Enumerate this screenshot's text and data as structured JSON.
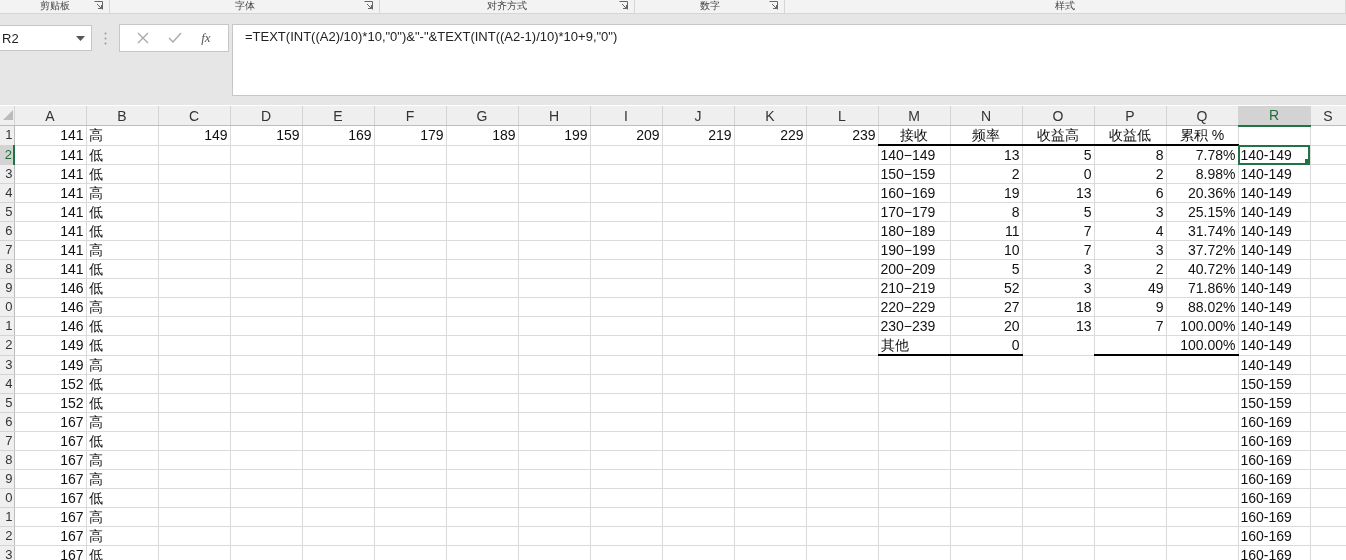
{
  "ribbon_groups": [
    {
      "label": "剪贴板",
      "launcher": true
    },
    {
      "label": "字体",
      "launcher": true
    },
    {
      "label": "对齐方式",
      "launcher": true
    },
    {
      "label": "数字",
      "launcher": true
    },
    {
      "label": "样式",
      "launcher": false
    }
  ],
  "formula_bar": {
    "name_box": "R2",
    "function_label": "fx",
    "formula": "=TEXT(INT((A2)/10)*10,\"0\")&\"-\"&TEXT(INT((A2-1)/10)*10+9,\"0\")"
  },
  "columns": [
    {
      "label": "A",
      "kind": "number",
      "selected": false
    },
    {
      "label": "B",
      "kind": "text",
      "selected": false
    },
    {
      "label": "C",
      "kind": "number",
      "selected": false
    },
    {
      "label": "D",
      "kind": "number",
      "selected": false
    },
    {
      "label": "E",
      "kind": "number",
      "selected": false
    },
    {
      "label": "F",
      "kind": "number",
      "selected": false
    },
    {
      "label": "G",
      "kind": "number",
      "selected": false
    },
    {
      "label": "H",
      "kind": "number",
      "selected": false
    },
    {
      "label": "I",
      "kind": "number",
      "selected": false
    },
    {
      "label": "J",
      "kind": "number",
      "selected": false
    },
    {
      "label": "K",
      "kind": "number",
      "selected": false
    },
    {
      "label": "L",
      "kind": "number",
      "selected": false
    },
    {
      "label": "M",
      "kind": "text",
      "selected": false
    },
    {
      "label": "N",
      "kind": "number",
      "selected": false
    },
    {
      "label": "O",
      "kind": "number",
      "selected": false
    },
    {
      "label": "P",
      "kind": "number",
      "selected": false
    },
    {
      "label": "Q",
      "kind": "number",
      "selected": false
    },
    {
      "label": "R",
      "kind": "text",
      "selected": true
    },
    {
      "label": "S",
      "selected": false
    }
  ],
  "rows": [
    {
      "header": "1",
      "selected": false,
      "cells": [
        "141",
        "高",
        "149",
        "159",
        "169",
        "179",
        "189",
        "199",
        "209",
        "219",
        "229",
        "239",
        {
          "text": "接收",
          "kind": "heading",
          "rule": true
        },
        {
          "text": "频率",
          "kind": "heading",
          "rule": true
        },
        {
          "text": "收益高",
          "kind": "heading",
          "rule": true
        },
        {
          "text": "收益低",
          "kind": "heading",
          "rule": true
        },
        {
          "text": "累积 %",
          "kind": "heading",
          "rule": true
        },
        null
      ]
    },
    {
      "header": "2",
      "selected": true,
      "cells": [
        "141",
        "低",
        null,
        null,
        null,
        null,
        null,
        null,
        null,
        null,
        null,
        null,
        "140−149",
        "13",
        "5",
        "8",
        "7.78%",
        {
          "text": "140-149",
          "selected": true
        }
      ]
    },
    {
      "header": "3",
      "selected": false,
      "cells": [
        "141",
        "低",
        null,
        null,
        null,
        null,
        null,
        null,
        null,
        null,
        null,
        null,
        "150−159",
        "2",
        "0",
        "2",
        "8.98%",
        "140-149"
      ]
    },
    {
      "header": "4",
      "selected": false,
      "cells": [
        "141",
        "高",
        null,
        null,
        null,
        null,
        null,
        null,
        null,
        null,
        null,
        null,
        "160−169",
        "19",
        "13",
        "6",
        "20.36%",
        "140-149"
      ]
    },
    {
      "header": "5",
      "selected": false,
      "cells": [
        "141",
        "低",
        null,
        null,
        null,
        null,
        null,
        null,
        null,
        null,
        null,
        null,
        "170−179",
        "8",
        "5",
        "3",
        "25.15%",
        "140-149"
      ]
    },
    {
      "header": "6",
      "selected": false,
      "cells": [
        "141",
        "低",
        null,
        null,
        null,
        null,
        null,
        null,
        null,
        null,
        null,
        null,
        "180−189",
        "11",
        "7",
        "4",
        "31.74%",
        "140-149"
      ]
    },
    {
      "header": "7",
      "selected": false,
      "cells": [
        "141",
        "高",
        null,
        null,
        null,
        null,
        null,
        null,
        null,
        null,
        null,
        null,
        "190−199",
        "10",
        "7",
        "3",
        "37.72%",
        "140-149"
      ]
    },
    {
      "header": "8",
      "selected": false,
      "cells": [
        "141",
        "低",
        null,
        null,
        null,
        null,
        null,
        null,
        null,
        null,
        null,
        null,
        "200−209",
        "5",
        "3",
        "2",
        "40.72%",
        "140-149"
      ]
    },
    {
      "header": "9",
      "selected": false,
      "cells": [
        "146",
        "低",
        null,
        null,
        null,
        null,
        null,
        null,
        null,
        null,
        null,
        null,
        "210−219",
        "52",
        "3",
        "49",
        "71.86%",
        "140-149"
      ]
    },
    {
      "header": "0",
      "selected": false,
      "cells": [
        "146",
        "高",
        null,
        null,
        null,
        null,
        null,
        null,
        null,
        null,
        null,
        null,
        "220−229",
        "27",
        "18",
        "9",
        "88.02%",
        "140-149"
      ]
    },
    {
      "header": "1",
      "selected": false,
      "cells": [
        "146",
        "低",
        null,
        null,
        null,
        null,
        null,
        null,
        null,
        null,
        null,
        null,
        "230−239",
        "20",
        "13",
        "7",
        "100.00%",
        "140-149"
      ]
    },
    {
      "header": "2",
      "selected": false,
      "cells": [
        "149",
        "低",
        null,
        null,
        null,
        null,
        null,
        null,
        null,
        null,
        null,
        null,
        {
          "text": "其他",
          "rule": true
        },
        {
          "text": "0",
          "rule": true
        },
        null,
        {
          "rule": true
        },
        {
          "text": "100.00%",
          "rule": true
        },
        "140-149"
      ]
    },
    {
      "header": "3",
      "selected": false,
      "cells": [
        "149",
        "高",
        null,
        null,
        null,
        null,
        null,
        null,
        null,
        null,
        null,
        null,
        null,
        null,
        null,
        null,
        null,
        "140-149"
      ]
    },
    {
      "header": "4",
      "selected": false,
      "cells": [
        "152",
        "低",
        null,
        null,
        null,
        null,
        null,
        null,
        null,
        null,
        null,
        null,
        null,
        null,
        null,
        null,
        null,
        "150-159"
      ]
    },
    {
      "header": "5",
      "selected": false,
      "cells": [
        "152",
        "低",
        null,
        null,
        null,
        null,
        null,
        null,
        null,
        null,
        null,
        null,
        null,
        null,
        null,
        null,
        null,
        "150-159"
      ]
    },
    {
      "header": "6",
      "selected": false,
      "cells": [
        "167",
        "高",
        null,
        null,
        null,
        null,
        null,
        null,
        null,
        null,
        null,
        null,
        null,
        null,
        null,
        null,
        null,
        "160-169"
      ]
    },
    {
      "header": "7",
      "selected": false,
      "cells": [
        "167",
        "低",
        null,
        null,
        null,
        null,
        null,
        null,
        null,
        null,
        null,
        null,
        null,
        null,
        null,
        null,
        null,
        "160-169"
      ]
    },
    {
      "header": "8",
      "selected": false,
      "cells": [
        "167",
        "高",
        null,
        null,
        null,
        null,
        null,
        null,
        null,
        null,
        null,
        null,
        null,
        null,
        null,
        null,
        null,
        "160-169"
      ]
    },
    {
      "header": "9",
      "selected": false,
      "cells": [
        "167",
        "高",
        null,
        null,
        null,
        null,
        null,
        null,
        null,
        null,
        null,
        null,
        null,
        null,
        null,
        null,
        null,
        "160-169"
      ]
    },
    {
      "header": "0",
      "selected": false,
      "cells": [
        "167",
        "低",
        null,
        null,
        null,
        null,
        null,
        null,
        null,
        null,
        null,
        null,
        null,
        null,
        null,
        null,
        null,
        "160-169"
      ]
    },
    {
      "header": "1",
      "selected": false,
      "cells": [
        "167",
        "高",
        null,
        null,
        null,
        null,
        null,
        null,
        null,
        null,
        null,
        null,
        null,
        null,
        null,
        null,
        null,
        "160-169"
      ]
    },
    {
      "header": "2",
      "selected": false,
      "cells": [
        "167",
        "高",
        null,
        null,
        null,
        null,
        null,
        null,
        null,
        null,
        null,
        null,
        null,
        null,
        null,
        null,
        null,
        "160-169"
      ]
    },
    {
      "header": "3",
      "selected": false,
      "cells": [
        "167",
        "低",
        null,
        null,
        null,
        null,
        null,
        null,
        null,
        null,
        null,
        null,
        null,
        null,
        null,
        null,
        null,
        "160-169"
      ]
    }
  ]
}
